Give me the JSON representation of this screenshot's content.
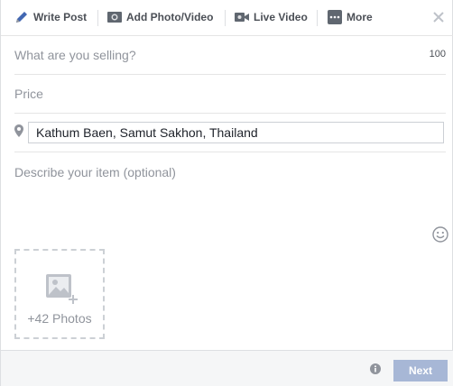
{
  "tabs": [
    {
      "label": "Write Post",
      "icon": "pencil-icon"
    },
    {
      "label": "Add Photo/Video",
      "icon": "camera-icon"
    },
    {
      "label": "Live Video",
      "icon": "video-camera-icon"
    },
    {
      "label": "More",
      "icon": "more-icon"
    }
  ],
  "form": {
    "title_placeholder": "What are you selling?",
    "title_char_limit": "100",
    "price_placeholder": "Price",
    "location_value": "Kathum Baen, Samut Sakhon, Thailand",
    "description_placeholder": "Describe your item (optional)"
  },
  "photos": {
    "count_label": "+42 Photos"
  },
  "footer": {
    "next_label": "Next"
  },
  "colors": {
    "tab_text": "#4b4f56",
    "placeholder": "#90949c",
    "next_button": "#a7b7d6",
    "footer_bg": "#f5f6f7"
  }
}
